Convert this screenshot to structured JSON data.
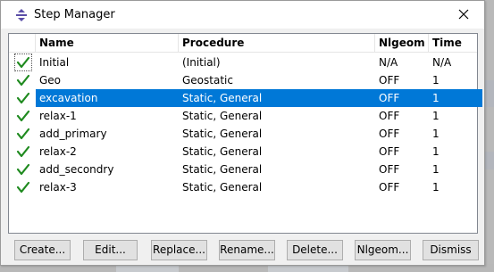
{
  "window": {
    "title": "Step Manager"
  },
  "table": {
    "headers": {
      "name": "Name",
      "procedure": "Procedure",
      "nlgeom": "Nlgeom",
      "time": "Time"
    },
    "rows": [
      {
        "checked": true,
        "name": "Initial",
        "procedure": "(Initial)",
        "nlgeom": "N/A",
        "time": "N/A",
        "selected": false
      },
      {
        "checked": true,
        "name": "Geo",
        "procedure": "Geostatic",
        "nlgeom": "OFF",
        "time": "1",
        "selected": false
      },
      {
        "checked": true,
        "name": "excavation",
        "procedure": "Static, General",
        "nlgeom": "OFF",
        "time": "1",
        "selected": true
      },
      {
        "checked": true,
        "name": "relax-1",
        "procedure": "Static, General",
        "nlgeom": "OFF",
        "time": "1",
        "selected": false
      },
      {
        "checked": true,
        "name": "add_primary",
        "procedure": "Static, General",
        "nlgeom": "OFF",
        "time": "1",
        "selected": false
      },
      {
        "checked": true,
        "name": "relax-2",
        "procedure": "Static, General",
        "nlgeom": "OFF",
        "time": "1",
        "selected": false
      },
      {
        "checked": true,
        "name": "add_secondry",
        "procedure": "Static, General",
        "nlgeom": "OFF",
        "time": "1",
        "selected": false
      },
      {
        "checked": true,
        "name": "relax-3",
        "procedure": "Static, General",
        "nlgeom": "OFF",
        "time": "1",
        "selected": false
      }
    ]
  },
  "buttons": {
    "create": "Create...",
    "edit": "Edit...",
    "replace": "Replace...",
    "rename": "Rename...",
    "delete": "Delete...",
    "nlgeom": "Nlgeom...",
    "dismiss": "Dismiss"
  },
  "colors": {
    "selection": "#0078d7",
    "check": "#1f8a1f",
    "app_icon": "#5b4ea8"
  },
  "icons": {
    "app": "step-manager-app-icon",
    "close": "close-icon",
    "check": "check-mark-icon"
  }
}
